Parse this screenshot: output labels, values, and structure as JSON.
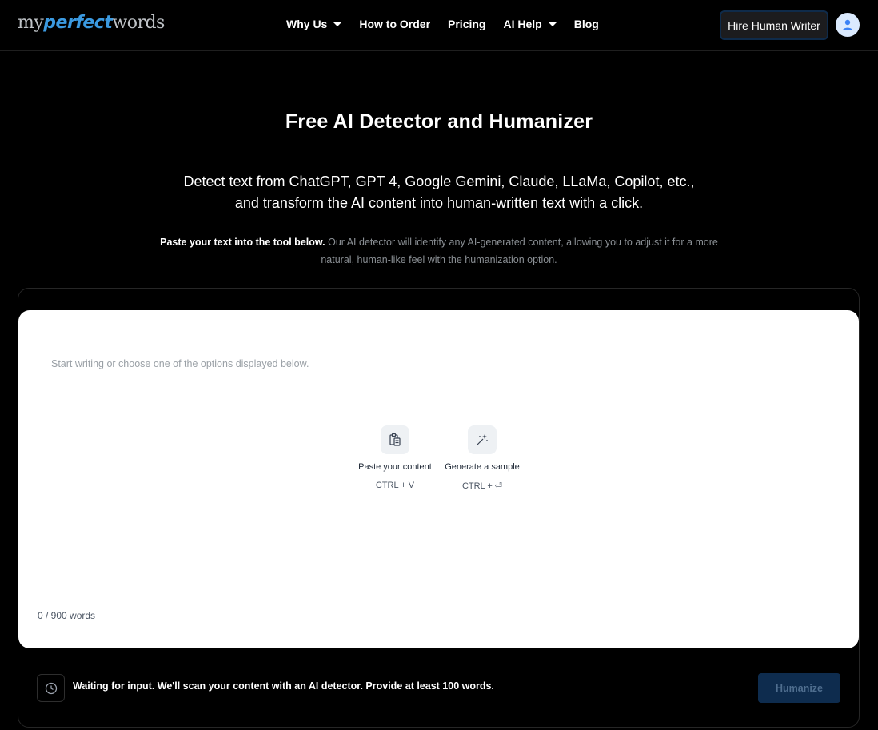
{
  "header": {
    "logo": {
      "part1": "my",
      "part2": "perfect",
      "part3": "words"
    },
    "nav": [
      {
        "label": "Why Us",
        "dropdown": true
      },
      {
        "label": "How to Order",
        "dropdown": false
      },
      {
        "label": "Pricing",
        "dropdown": false
      },
      {
        "label": "AI Help",
        "dropdown": true
      },
      {
        "label": "Blog",
        "dropdown": false
      }
    ],
    "hire_button": "Hire Human Writer"
  },
  "hero": {
    "title": "Free AI Detector and Humanizer",
    "subtitle_line1": "Detect text from ChatGPT, GPT 4, Google Gemini, Claude, LLaMa, Copilot, etc.,",
    "subtitle_line2": "and transform the AI content into human-written text with a click.",
    "desc_strong": "Paste your text into the tool below.",
    "desc_rest": " Our AI detector will identify any AI-generated content, allowing you to adjust it for a more natural, human-like feel with the humanization option."
  },
  "editor": {
    "placeholder": "Start writing or choose one of the options displayed below.",
    "options": [
      {
        "label": "Paste your content",
        "shortcut": "CTRL + V"
      },
      {
        "label": "Generate a sample",
        "shortcut": "CTRL + ⏎"
      }
    ],
    "word_count": "0 / 900 words"
  },
  "status": {
    "message": "Waiting for input. We'll scan your content with an AI detector. Provide at least 100 words.",
    "humanize_button": "Humanize"
  },
  "colors": {
    "accent": "#3b9ae1",
    "humanize_bg": "#0e2c4e"
  }
}
